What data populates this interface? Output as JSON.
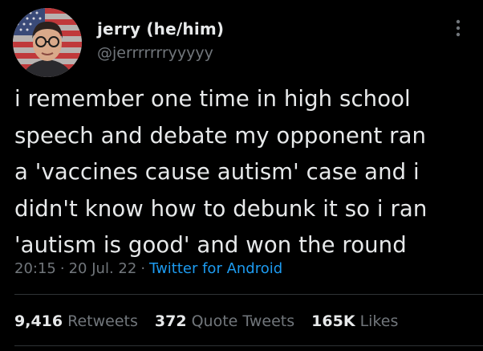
{
  "author": {
    "name": "jerry (he/him)",
    "handle": "@jerrrrrrryyyyy",
    "avatar": "profile-photo-with-american-flag-background"
  },
  "tweet": {
    "text": "i remember one time in high school\nspeech and debate my opponent ran\na 'vaccines cause autism' case and i\ndidn't know how to debunk it so i ran\n'autism is good' and won the round",
    "time": "20:15",
    "date": "20 Jul. 22",
    "source": "Twitter for Android",
    "separator": "·"
  },
  "stats": {
    "retweets": {
      "count": "9,416",
      "label": "Retweets"
    },
    "quote_tweets": {
      "count": "372",
      "label": "Quote Tweets"
    },
    "likes": {
      "count": "165K",
      "label": "Likes"
    }
  },
  "icons": {
    "more": "more-vertical-icon"
  },
  "colors": {
    "background": "#000000",
    "primary_text": "#e7e9ea",
    "secondary_text": "#71767b",
    "link": "#1d9bf0",
    "divider": "#2f3336"
  }
}
